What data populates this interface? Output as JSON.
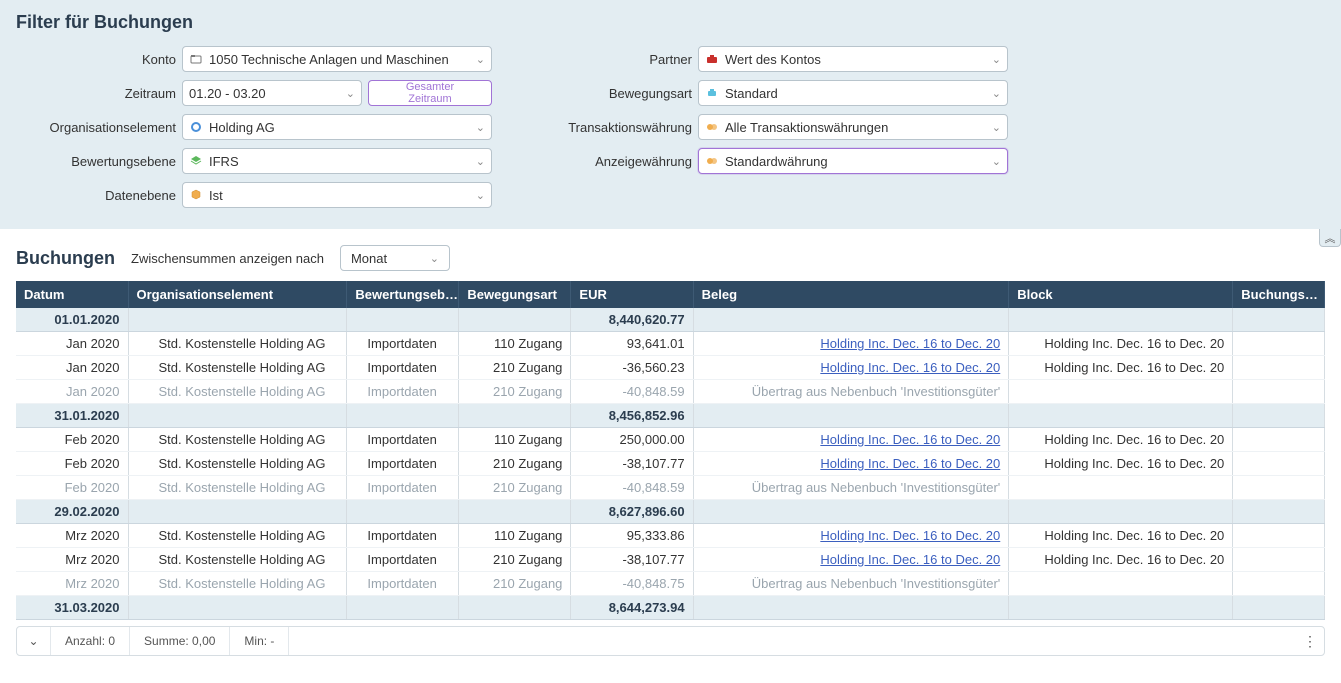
{
  "filter": {
    "title": "Filter für Buchungen",
    "left": {
      "konto": {
        "label": "Konto",
        "value": "1050 Technische Anlagen und Maschinen"
      },
      "zeitraum": {
        "label": "Zeitraum",
        "value": "01.20 - 03.20",
        "button": "Gesamter\nZeitraum"
      },
      "org": {
        "label": "Organisationselement",
        "value": "Holding AG"
      },
      "bewertung": {
        "label": "Bewertungsebene",
        "value": "IFRS"
      },
      "daten": {
        "label": "Datenebene",
        "value": "Ist"
      }
    },
    "right": {
      "partner": {
        "label": "Partner",
        "value": "Wert des Kontos"
      },
      "bewegung": {
        "label": "Bewegungsart",
        "value": "Standard"
      },
      "trans": {
        "label": "Transaktionswährung",
        "value": "Alle Transaktionswährungen"
      },
      "anzeige": {
        "label": "Anzeigewährung",
        "value": "Standardwährung"
      }
    }
  },
  "section": {
    "title": "Buchungen",
    "subtotal_label": "Zwischensummen anzeigen nach",
    "subtotal_value": "Monat"
  },
  "columns": [
    "Datum",
    "Organisationselement",
    "Bewertungseb…",
    "Bewegungsart",
    "EUR",
    "Beleg",
    "Block",
    "Buchungs…"
  ],
  "rows": [
    {
      "type": "subtotal",
      "date": "01.01.2020",
      "eur": "8,440,620.77"
    },
    {
      "type": "row",
      "date": "Jan 2020",
      "org": "Std. Kostenstelle Holding AG",
      "bew": "Importdaten",
      "mov": "110 Zugang",
      "eur": "93,641.01",
      "beleg": "Holding Inc. Dec. 16 to Dec. 20",
      "beleg_link": true,
      "block": "Holding Inc. Dec. 16 to Dec. 20"
    },
    {
      "type": "row",
      "date": "Jan 2020",
      "org": "Std. Kostenstelle Holding AG",
      "bew": "Importdaten",
      "mov": "210 Zugang",
      "eur": "-36,560.23",
      "beleg": "Holding Inc. Dec. 16 to Dec. 20",
      "beleg_link": true,
      "block": "Holding Inc. Dec. 16 to Dec. 20"
    },
    {
      "type": "muted",
      "date": "Jan 2020",
      "org": "Std. Kostenstelle Holding AG",
      "bew": "Importdaten",
      "mov": "210 Zugang",
      "eur": "-40,848.59",
      "beleg": "Übertrag aus Nebenbuch 'Investitionsgüter'",
      "beleg_link": false,
      "block": ""
    },
    {
      "type": "subtotal",
      "date": "31.01.2020",
      "eur": "8,456,852.96"
    },
    {
      "type": "row",
      "date": "Feb 2020",
      "org": "Std. Kostenstelle Holding AG",
      "bew": "Importdaten",
      "mov": "110 Zugang",
      "eur": "250,000.00",
      "beleg": "Holding Inc. Dec. 16 to Dec. 20",
      "beleg_link": true,
      "block": "Holding Inc. Dec. 16 to Dec. 20"
    },
    {
      "type": "row",
      "date": "Feb 2020",
      "org": "Std. Kostenstelle Holding AG",
      "bew": "Importdaten",
      "mov": "210 Zugang",
      "eur": "-38,107.77",
      "beleg": "Holding Inc. Dec. 16 to Dec. 20",
      "beleg_link": true,
      "block": "Holding Inc. Dec. 16 to Dec. 20"
    },
    {
      "type": "muted",
      "date": "Feb 2020",
      "org": "Std. Kostenstelle Holding AG",
      "bew": "Importdaten",
      "mov": "210 Zugang",
      "eur": "-40,848.59",
      "beleg": "Übertrag aus Nebenbuch 'Investitionsgüter'",
      "beleg_link": false,
      "block": ""
    },
    {
      "type": "subtotal",
      "date": "29.02.2020",
      "eur": "8,627,896.60"
    },
    {
      "type": "row",
      "date": "Mrz 2020",
      "org": "Std. Kostenstelle Holding AG",
      "bew": "Importdaten",
      "mov": "110 Zugang",
      "eur": "95,333.86",
      "beleg": "Holding Inc. Dec. 16 to Dec. 20",
      "beleg_link": true,
      "block": "Holding Inc. Dec. 16 to Dec. 20"
    },
    {
      "type": "row",
      "date": "Mrz 2020",
      "org": "Std. Kostenstelle Holding AG",
      "bew": "Importdaten",
      "mov": "210 Zugang",
      "eur": "-38,107.77",
      "beleg": "Holding Inc. Dec. 16 to Dec. 20",
      "beleg_link": true,
      "block": "Holding Inc. Dec. 16 to Dec. 20"
    },
    {
      "type": "muted",
      "date": "Mrz 2020",
      "org": "Std. Kostenstelle Holding AG",
      "bew": "Importdaten",
      "mov": "210 Zugang",
      "eur": "-40,848.75",
      "beleg": "Übertrag aus Nebenbuch 'Investitionsgüter'",
      "beleg_link": false,
      "block": ""
    },
    {
      "type": "subtotal",
      "date": "31.03.2020",
      "eur": "8,644,273.94"
    }
  ],
  "footer": {
    "count": "Anzahl: 0",
    "sum": "Summe: 0,00",
    "min": "Min: -"
  }
}
